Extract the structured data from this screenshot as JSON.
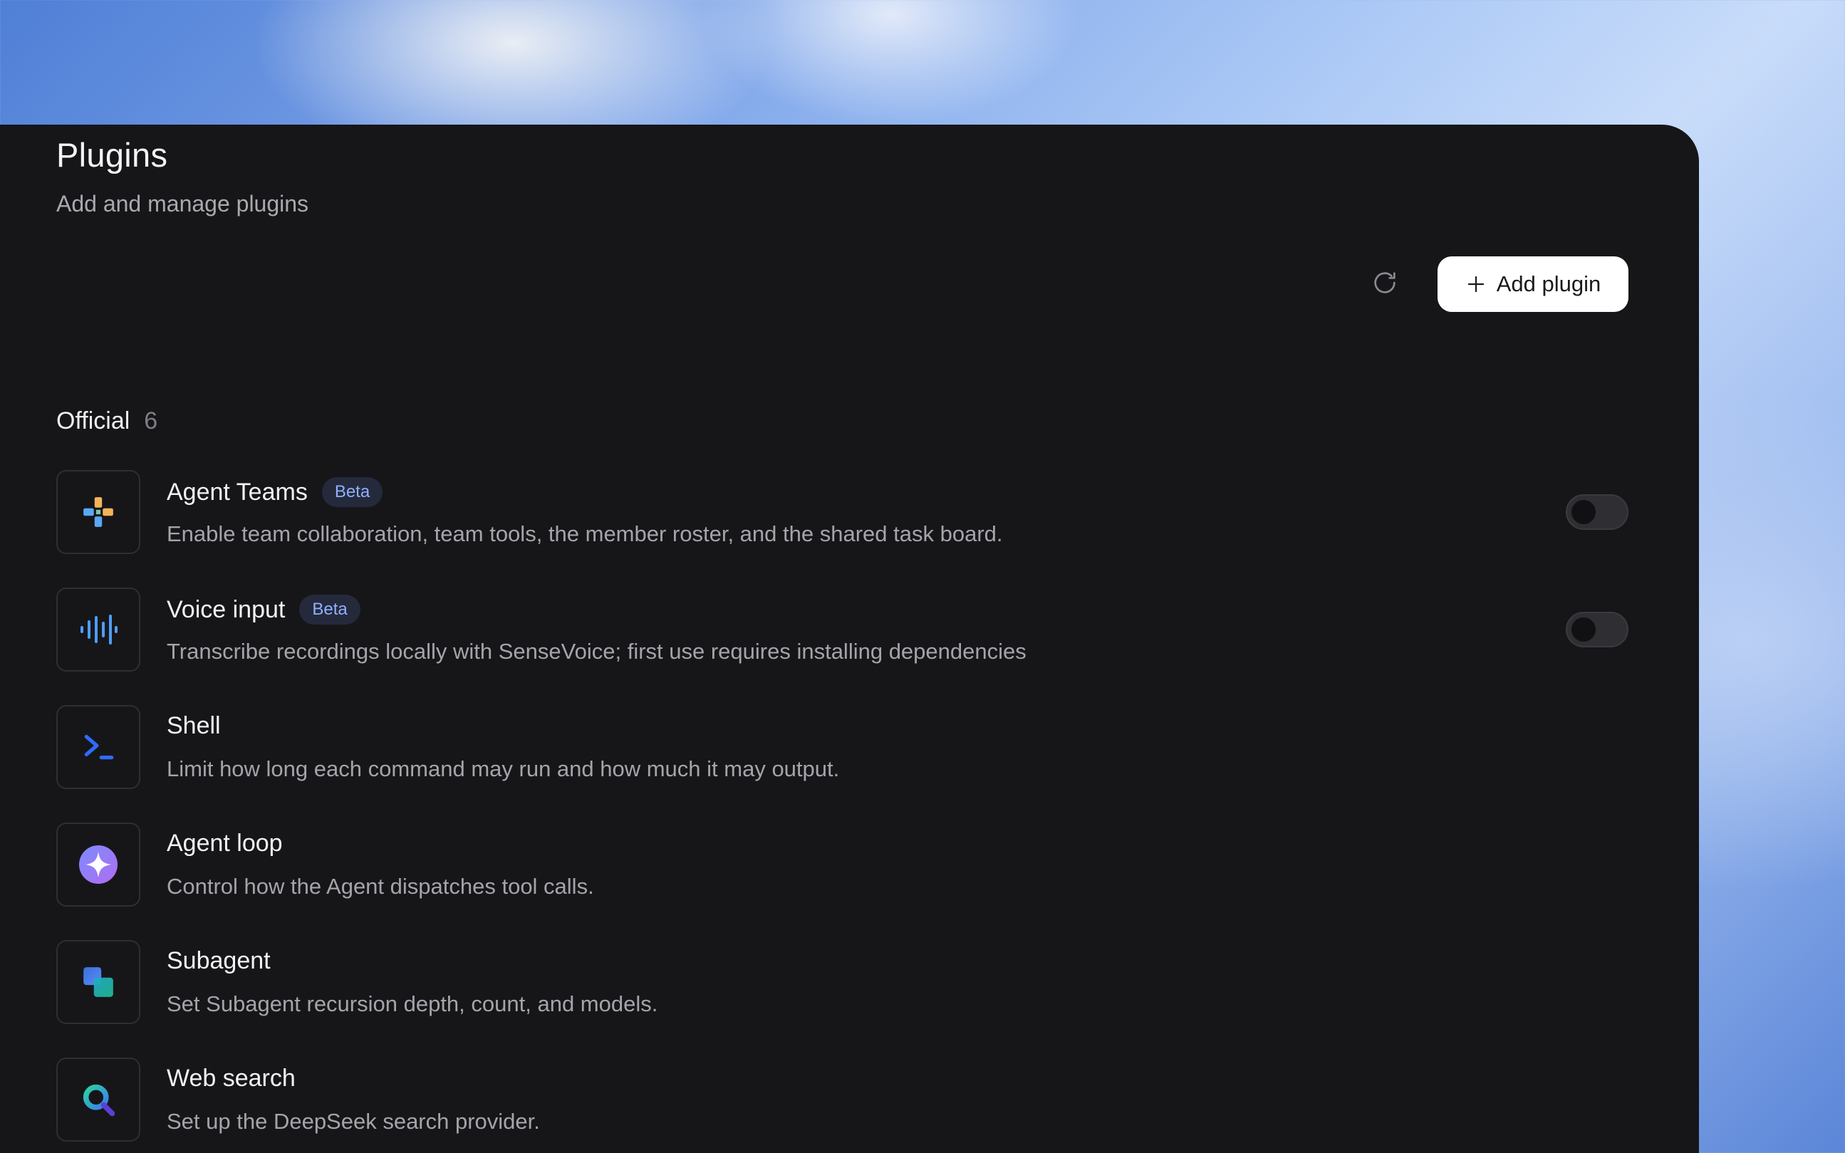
{
  "header": {
    "title": "Plugins",
    "subtitle": "Add and manage plugins",
    "add_button_label": "Add plugin",
    "refresh_icon": "refresh-icon",
    "add_icon": "plus-icon"
  },
  "section": {
    "title": "Official",
    "count": "6"
  },
  "plugins": [
    {
      "name": "Agent Teams",
      "badge": "Beta",
      "description": "Enable team collaboration, team tools, the member roster, and the shared task board.",
      "icon": "agent-teams-icon",
      "toggle": "off"
    },
    {
      "name": "Voice input",
      "badge": "Beta",
      "description": "Transcribe recordings locally with SenseVoice; first use requires installing dependencies",
      "icon": "waveform-icon",
      "toggle": "off"
    },
    {
      "name": "Shell",
      "description": "Limit how long each command may run and how much it may output.",
      "icon": "terminal-icon"
    },
    {
      "name": "Agent loop",
      "description": "Control how the Agent dispatches tool calls.",
      "icon": "sparkle-icon"
    },
    {
      "name": "Subagent",
      "description": "Set Subagent recursion depth, count, and models.",
      "icon": "subagent-icon"
    },
    {
      "name": "Web search",
      "description": "Set up the DeepSeek search provider.",
      "icon": "search-icon"
    }
  ],
  "colors": {
    "panel_background": "#161619",
    "accent_blue": "#2f6bff",
    "badge_text": "#8fb0ff"
  }
}
